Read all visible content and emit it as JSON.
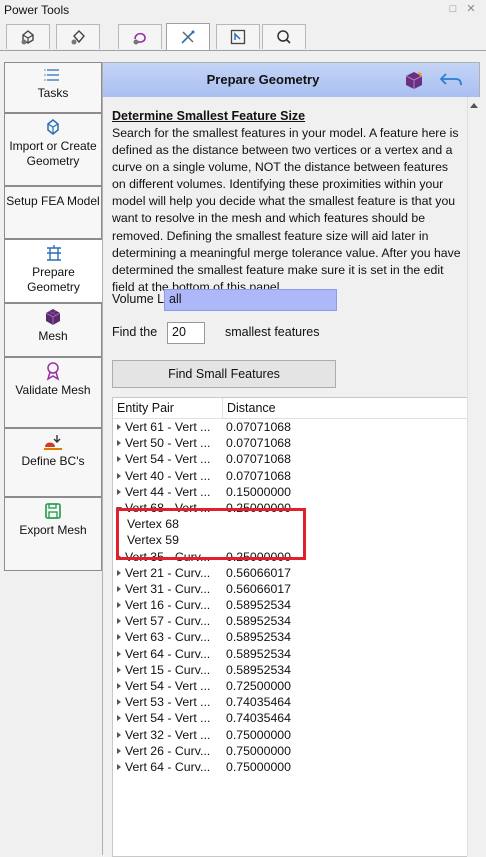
{
  "window": {
    "title": "Power Tools"
  },
  "tabs": [
    {
      "icon": "mesh-tools-icon"
    },
    {
      "icon": "geometry-tools-icon"
    },
    {
      "icon": "fea-tools-icon"
    },
    {
      "icon": "wizard-icon",
      "active": true
    },
    {
      "icon": "layout-icon"
    },
    {
      "icon": "search-icon"
    }
  ],
  "sidebar": {
    "items": [
      {
        "label": "Tasks",
        "icon": "list-icon"
      },
      {
        "label": "Import or Create Geometry",
        "icon": "import-geometry-icon"
      },
      {
        "label": "Setup FEA Model",
        "icon": ""
      },
      {
        "label": "Prepare Geometry",
        "icon": "prepare-geometry-icon",
        "active": true
      },
      {
        "label": "Mesh",
        "icon": "mesh-cube-icon"
      },
      {
        "label": "Validate Mesh",
        "icon": "validate-mesh-icon"
      },
      {
        "label": "Define BC's",
        "icon": "boundary-conditions-icon"
      },
      {
        "label": "Export Mesh",
        "icon": "save-icon"
      }
    ]
  },
  "header": {
    "title": "Prepare Geometry"
  },
  "section": {
    "title": "Determine Smallest Feature Size",
    "description": "Search for the smallest features in your model. A feature here is defined as the distance between two vertices or a vertex and a curve on a single volume, NOT the distance between features on different volumes. Identifying these proximities within your model will help you decide what the smallest feature is that you want to resolve in the mesh and which features should be removed. Defining the smallest feature size will aid later in determining a meaningful merge tolerance value. After you have determined the smallest feature make sure it is set in the edit field at the bottom of this panel."
  },
  "form": {
    "volume_label": "Volume List",
    "volume_value": "all",
    "find_prefix": "Find the",
    "count_value": "20",
    "find_suffix": "smallest features",
    "find_button": "Find Small Features"
  },
  "table": {
    "columns": [
      "Entity Pair",
      "Distance"
    ],
    "rows": [
      {
        "pair": "Vert 61 - Vert ...",
        "distance": "0.07071068"
      },
      {
        "pair": "Vert 50 - Vert ...",
        "distance": "0.07071068"
      },
      {
        "pair": "Vert 54 - Vert ...",
        "distance": "0.07071068"
      },
      {
        "pair": "Vert 40 - Vert ...",
        "distance": "0.07071068"
      },
      {
        "pair": "Vert 44 - Vert ...",
        "distance": "0.15000000"
      },
      {
        "pair": "Vert 68 - Vert ...",
        "distance": "0.25000000",
        "expanded": true,
        "children": [
          "Vertex 68",
          "Vertex 59"
        ]
      },
      {
        "pair": "Vert 35 - Curv...",
        "distance": "0.25000000"
      },
      {
        "pair": "Vert 21 - Curv...",
        "distance": "0.56066017"
      },
      {
        "pair": "Vert 31 - Curv...",
        "distance": "0.56066017"
      },
      {
        "pair": "Vert 16 - Curv...",
        "distance": "0.58952534"
      },
      {
        "pair": "Vert 57 - Curv...",
        "distance": "0.58952534"
      },
      {
        "pair": "Vert 63 - Curv...",
        "distance": "0.58952534"
      },
      {
        "pair": "Vert 64 - Curv...",
        "distance": "0.58952534"
      },
      {
        "pair": "Vert 15 - Curv...",
        "distance": "0.58952534"
      },
      {
        "pair": "Vert 54 - Vert ...",
        "distance": "0.72500000"
      },
      {
        "pair": "Vert 53 - Vert ...",
        "distance": "0.74035464"
      },
      {
        "pair": "Vert 54 - Vert ...",
        "distance": "0.74035464"
      },
      {
        "pair": "Vert 32 - Vert ...",
        "distance": "0.75000000"
      },
      {
        "pair": "Vert 26 - Curv...",
        "distance": "0.75000000"
      },
      {
        "pair": "Vert 64 - Curv...",
        "distance": "0.75000000"
      }
    ]
  },
  "colors": {
    "header_bg": "#b2c6f3",
    "volume_field_bg": "#aeb7f7",
    "highlight_box": "#e0202a",
    "accent_icon": "#2a6fb5"
  }
}
